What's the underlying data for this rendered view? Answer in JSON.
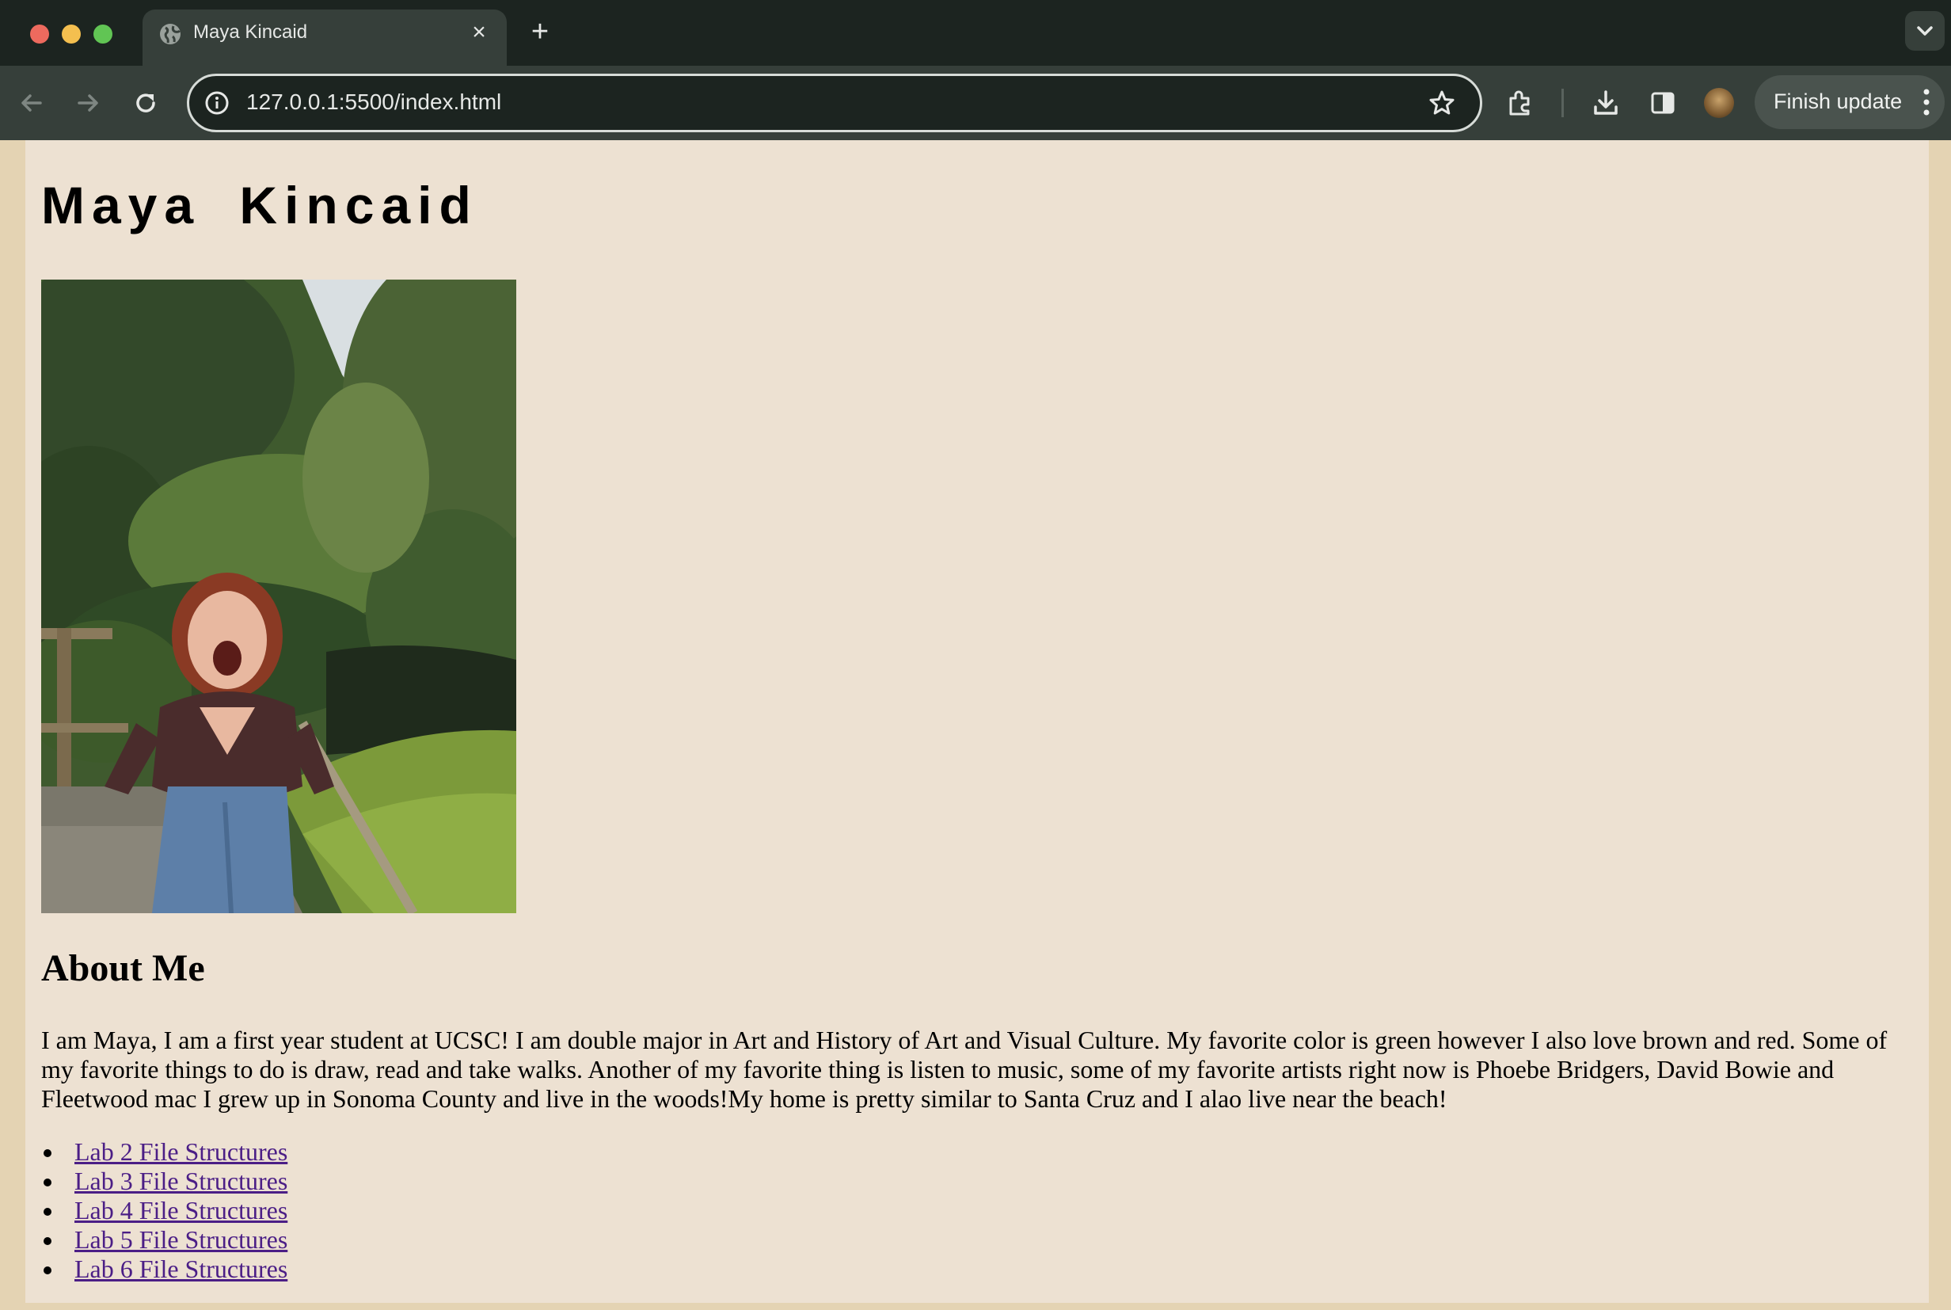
{
  "browser": {
    "tab": {
      "title": "Maya Kincaid",
      "favicon": "globe-icon"
    },
    "address_bar": {
      "url": "127.0.0.1:5500/index.html"
    },
    "finish_update_label": "Finish update",
    "colors": {
      "frame": "#1c2420",
      "toolbar": "#363f3a"
    }
  },
  "page": {
    "title": "Maya Kincaid",
    "about_heading": "About Me",
    "about_text": "I am Maya, I am a first year student at UCSC! I am double major in Art and History of Art and Visual Culture. My favorite color is green however I also love brown and red. Some of my favorite things to do is draw, read and take walks. Another of my favorite thing is listen to music, some of my favorite artists right now is Phoebe Bridgers, David Bowie and Fleetwood mac I grew up in Sonoma County and live in the woods!My home is pretty similar to Santa Cruz and I alao live near the beach!",
    "links": [
      {
        "label": "Lab 2 File Structures"
      },
      {
        "label": "Lab 3 File Structures"
      },
      {
        "label": "Lab 4 File Structures"
      },
      {
        "label": "Lab 5 File Structures"
      },
      {
        "label": "Lab 6 File Structures"
      }
    ],
    "colors": {
      "background": "#ede1d2",
      "link": "#4b1e86"
    }
  }
}
